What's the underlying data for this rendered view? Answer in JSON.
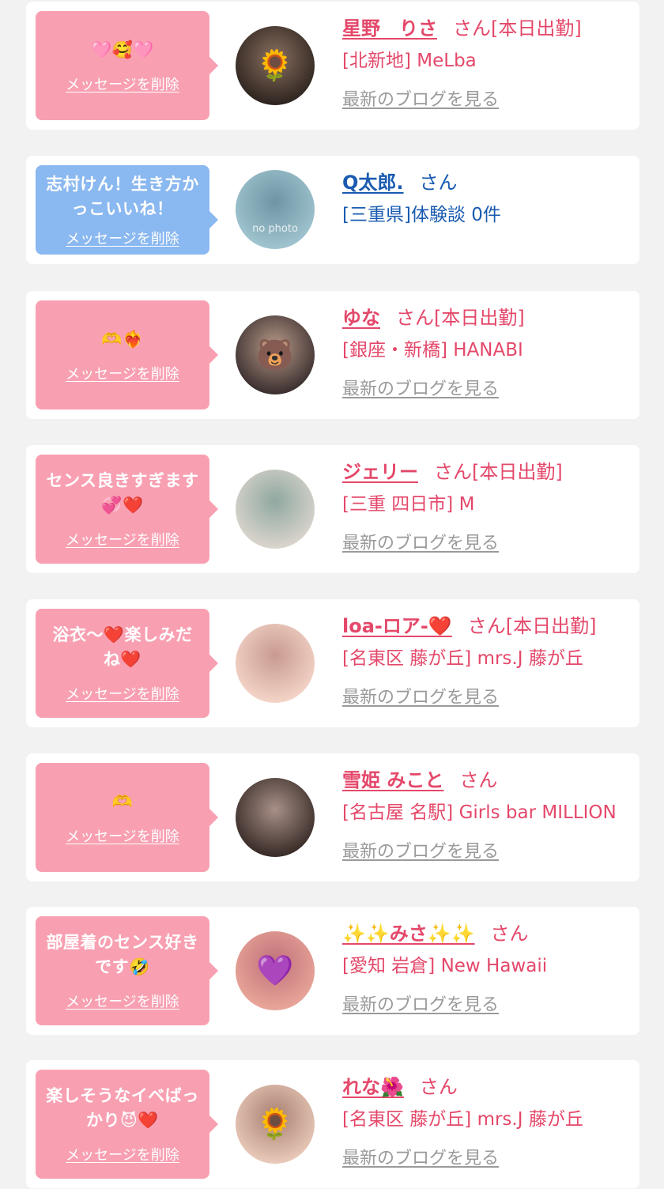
{
  "common": {
    "delete_label": "メッセージを削除",
    "blog_label": "最新のブログを見る",
    "no_photo": "no photo"
  },
  "items": [
    {
      "message_parts": [
        "🩷🥰🩷"
      ],
      "name": "星野　りさ",
      "suffix": "さん[本日出勤]",
      "shop": "[北新地] MeLba",
      "theme": "pink"
    },
    {
      "message_parts": [
        "志村けん！生き方かっこいいね！"
      ],
      "name": "Q太郎.",
      "suffix": "さん",
      "shop": "[三重県]体験談 0件",
      "theme": "blue"
    },
    {
      "message_parts": [
        "🫶❤️‍🔥"
      ],
      "name": "ゆな",
      "suffix": "さん[本日出勤]",
      "shop": "[銀座・新橋] HANABI",
      "theme": "pink"
    },
    {
      "message_parts": [
        "センス良きすぎます💞❤️"
      ],
      "name": "ジェリー",
      "suffix": "さん[本日出勤]",
      "shop": "[三重 四日市] M",
      "theme": "pink"
    },
    {
      "message_parts": [
        "浴衣〜❤️楽しみだね❤️"
      ],
      "name": "loa-ロア-❤️",
      "suffix": "さん[本日出勤]",
      "shop": "[名東区 藤が丘] mrs.J 藤が丘",
      "theme": "pink"
    },
    {
      "message_parts": [
        "🫶"
      ],
      "name": "雪姫 みこと",
      "suffix": "さん",
      "shop": "[名古屋 名駅] Girls bar MILLION",
      "theme": "pink"
    },
    {
      "message_parts": [
        "部屋着のセンス好きです🤣"
      ],
      "name": "✨✨みさ✨✨",
      "suffix": "さん",
      "shop": "[愛知 岩倉] New Hawaii",
      "theme": "pink"
    },
    {
      "message_parts": [
        "楽しそうなイベばっかり😈❤️"
      ],
      "name": "れな🌺",
      "suffix": "さん",
      "shop": "[名東区 藤が丘] mrs.J 藤が丘",
      "theme": "pink"
    }
  ],
  "avatars": {
    "0": {
      "overlay": "🌻",
      "colors": [
        "#2f2520",
        "#8a7060"
      ]
    },
    "1": {
      "overlay": "",
      "colors": [
        "#9fc4cf",
        "#6f95a4"
      ]
    },
    "2": {
      "overlay": "🐻",
      "colors": [
        "#3c3030",
        "#b89a88"
      ]
    },
    "3": {
      "overlay": "",
      "colors": [
        "#d9d4cc",
        "#8fa8a0"
      ]
    },
    "4": {
      "overlay": "",
      "colors": [
        "#f3d3c6",
        "#c89a90"
      ]
    },
    "5": {
      "overlay": "",
      "colors": [
        "#3a2c28",
        "#a89088"
      ]
    },
    "6": {
      "overlay": "💜",
      "colors": [
        "#e8a598",
        "#c0707a"
      ]
    },
    "7": {
      "overlay": "🌻",
      "colors": [
        "#e8c8b8",
        "#a88070"
      ]
    }
  }
}
